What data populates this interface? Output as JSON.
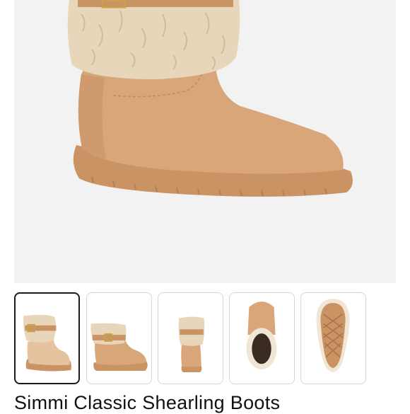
{
  "product": {
    "title": "Simmi Classic Shearling Boots",
    "main_image": "boot-side-view",
    "thumbnails": [
      {
        "view": "angled-front",
        "selected": true
      },
      {
        "view": "side",
        "selected": false
      },
      {
        "view": "back",
        "selected": false
      },
      {
        "view": "top-down",
        "selected": false
      },
      {
        "view": "sole",
        "selected": false
      }
    ]
  },
  "colors": {
    "suede": "#d9a67a",
    "fur": "#e8d6bb",
    "background": "#f2f2f2",
    "selected_border": "#1a1a1a"
  }
}
